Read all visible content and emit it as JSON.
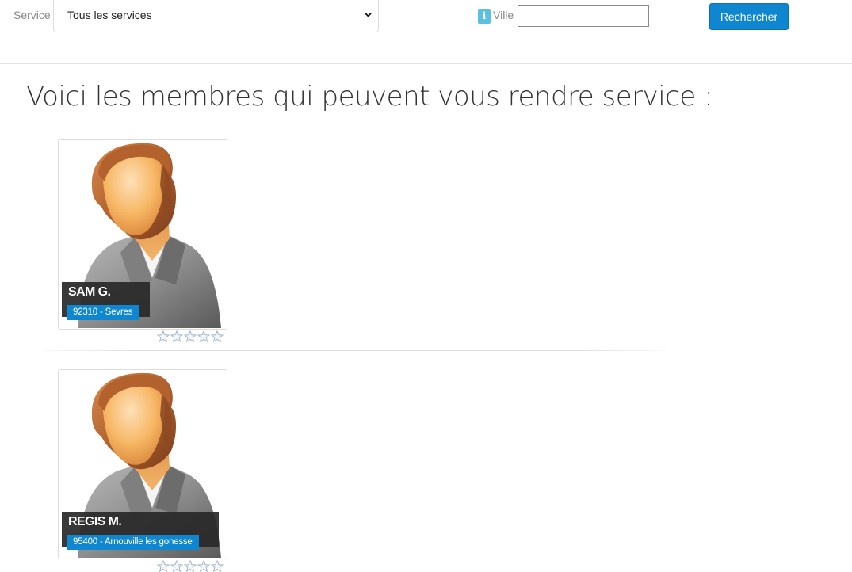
{
  "search": {
    "service_label": "Service",
    "service_selected": "Tous les services",
    "ville_label": "Ville",
    "ville_value": "",
    "info_icon_glyph": "i",
    "button_label": "Rechercher"
  },
  "page": {
    "title": "Voici les membres qui peuvent vous rendre service :"
  },
  "members": [
    {
      "name": "SAM G.",
      "location": "92310 - Sevres",
      "rating": 0,
      "rating_max": 5
    },
    {
      "name": "REGIS M.",
      "location": "95400 - Arnouville les gonesse",
      "rating": 0,
      "rating_max": 5
    }
  ],
  "colors": {
    "accent": "#0e87d0",
    "info": "#5bc0de",
    "name_plate": "#282828"
  },
  "icons": {
    "avatar": "default-male-avatar-icon",
    "rating_star": "star-outline-icon",
    "info": "info-icon",
    "select_arrow": "chevron-down-icon"
  }
}
